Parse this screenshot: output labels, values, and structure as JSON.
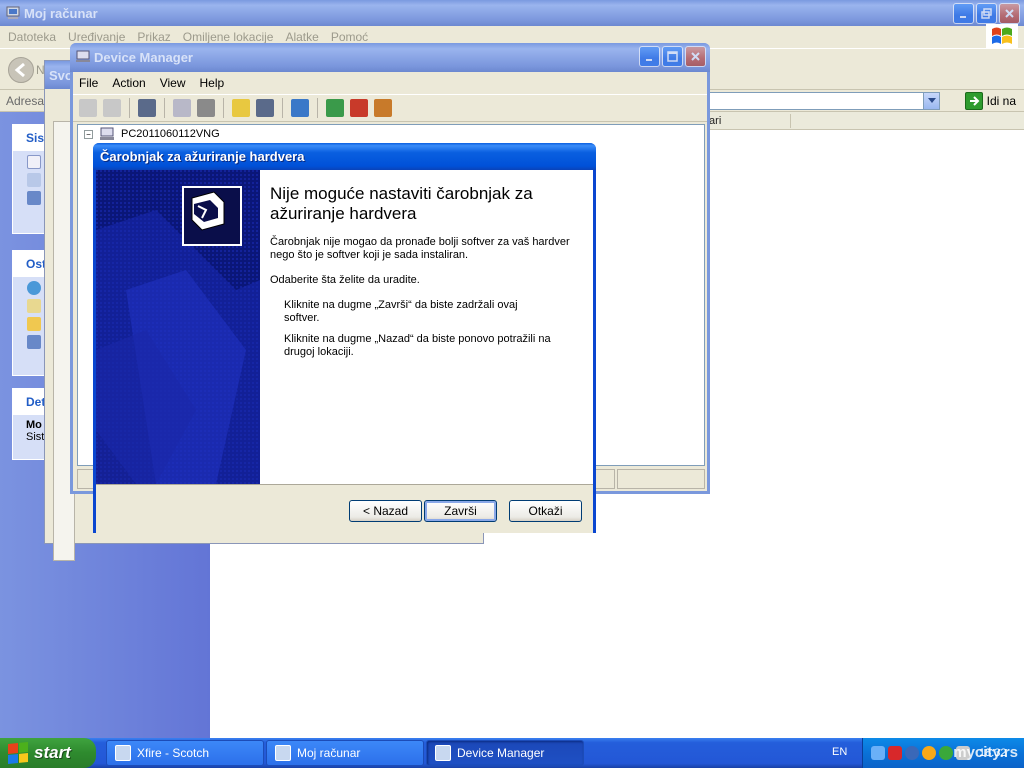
{
  "explorer": {
    "title": "Moj računar",
    "menu": [
      "Datoteka",
      "Uređivanje",
      "Prikaz",
      "Omiljene lokacije",
      "Alatke",
      "Pomoć"
    ],
    "toolbar_partial_label": "Svo",
    "back_partial_label": "N",
    "address_label": "Adresa",
    "go_label": "Idi na",
    "column_header_partial": "tari",
    "task_boxes": [
      {
        "head": "Sist"
      },
      {
        "head": "Ost"
      },
      {
        "head": "Det",
        "line1": "Mo",
        "line2": "Sist"
      }
    ]
  },
  "device_manager": {
    "title": "Device Manager",
    "menu": [
      "File",
      "Action",
      "View",
      "Help"
    ],
    "tree_root": "PC2011060112VNG"
  },
  "wizard": {
    "title": "Čarobnjak za ažuriranje hardvera",
    "heading": "Nije moguće nastaviti čarobnjak za ažuriranje hardvera",
    "paragraph1": "Čarobnjak nije mogao da pronađe bolji softver za vaš hardver nego što je softver koji je sada instaliran.",
    "paragraph2": "Odaberite šta želite da uradite.",
    "option1": "Kliknite na dugme „Završi“ da biste zadržali ovaj softver.",
    "option2": "Kliknite na dugme „Nazad“ da biste ponovo potražili na drugoj lokaciji.",
    "buttons": {
      "back": "< Nazad",
      "finish": "Završi",
      "cancel": "Otkaži"
    }
  },
  "taskbar": {
    "start": "start",
    "tasks": [
      {
        "label": "Xfire - Scotch",
        "active": false
      },
      {
        "label": "Moj računar",
        "active": false
      },
      {
        "label": "Device Manager",
        "active": true
      }
    ],
    "language": "EN",
    "clock": "18:32",
    "watermark": "mycity.rs"
  },
  "colors": {
    "title_blue": "#0a5fe0",
    "xp_gray": "#ece9d8",
    "start_green": "#2e8a2e",
    "wizard_side": "#0a1a7a"
  }
}
